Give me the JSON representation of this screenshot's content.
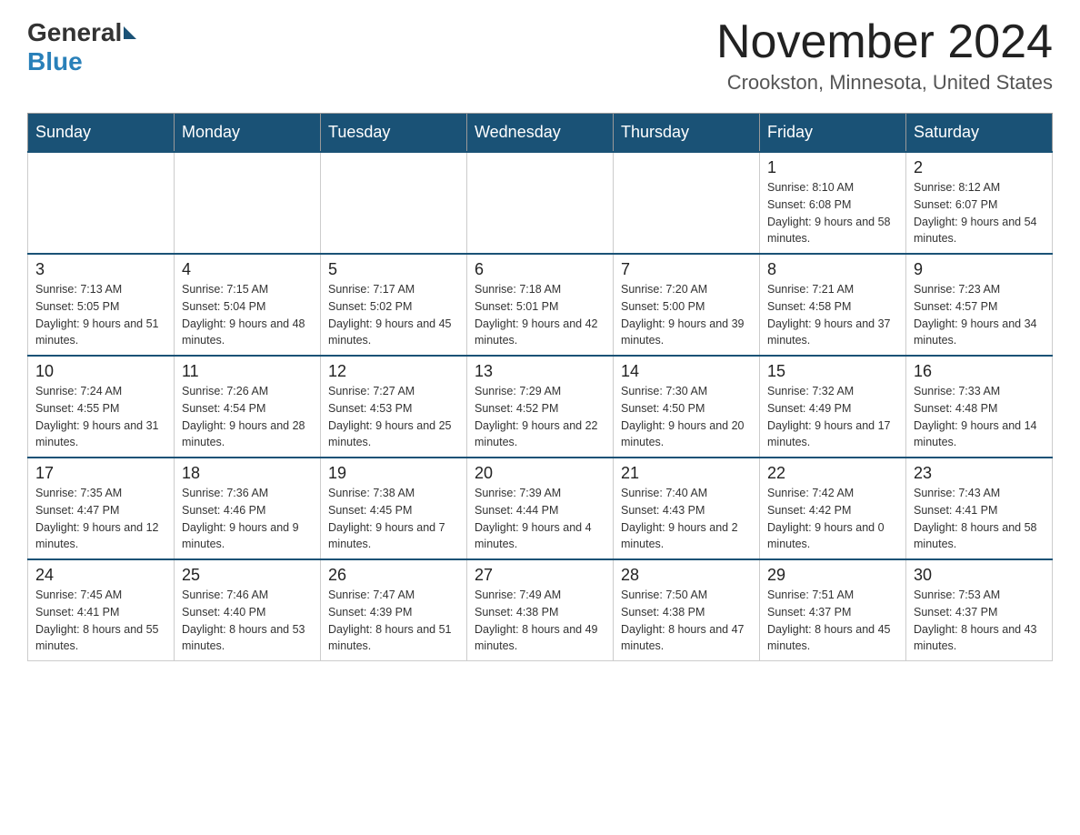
{
  "header": {
    "logo_general": "General",
    "logo_blue": "Blue",
    "month_title": "November 2024",
    "location": "Crookston, Minnesota, United States"
  },
  "days_of_week": [
    "Sunday",
    "Monday",
    "Tuesday",
    "Wednesday",
    "Thursday",
    "Friday",
    "Saturday"
  ],
  "weeks": [
    [
      {
        "day": "",
        "info": ""
      },
      {
        "day": "",
        "info": ""
      },
      {
        "day": "",
        "info": ""
      },
      {
        "day": "",
        "info": ""
      },
      {
        "day": "",
        "info": ""
      },
      {
        "day": "1",
        "info": "Sunrise: 8:10 AM\nSunset: 6:08 PM\nDaylight: 9 hours and 58 minutes."
      },
      {
        "day": "2",
        "info": "Sunrise: 8:12 AM\nSunset: 6:07 PM\nDaylight: 9 hours and 54 minutes."
      }
    ],
    [
      {
        "day": "3",
        "info": "Sunrise: 7:13 AM\nSunset: 5:05 PM\nDaylight: 9 hours and 51 minutes."
      },
      {
        "day": "4",
        "info": "Sunrise: 7:15 AM\nSunset: 5:04 PM\nDaylight: 9 hours and 48 minutes."
      },
      {
        "day": "5",
        "info": "Sunrise: 7:17 AM\nSunset: 5:02 PM\nDaylight: 9 hours and 45 minutes."
      },
      {
        "day": "6",
        "info": "Sunrise: 7:18 AM\nSunset: 5:01 PM\nDaylight: 9 hours and 42 minutes."
      },
      {
        "day": "7",
        "info": "Sunrise: 7:20 AM\nSunset: 5:00 PM\nDaylight: 9 hours and 39 minutes."
      },
      {
        "day": "8",
        "info": "Sunrise: 7:21 AM\nSunset: 4:58 PM\nDaylight: 9 hours and 37 minutes."
      },
      {
        "day": "9",
        "info": "Sunrise: 7:23 AM\nSunset: 4:57 PM\nDaylight: 9 hours and 34 minutes."
      }
    ],
    [
      {
        "day": "10",
        "info": "Sunrise: 7:24 AM\nSunset: 4:55 PM\nDaylight: 9 hours and 31 minutes."
      },
      {
        "day": "11",
        "info": "Sunrise: 7:26 AM\nSunset: 4:54 PM\nDaylight: 9 hours and 28 minutes."
      },
      {
        "day": "12",
        "info": "Sunrise: 7:27 AM\nSunset: 4:53 PM\nDaylight: 9 hours and 25 minutes."
      },
      {
        "day": "13",
        "info": "Sunrise: 7:29 AM\nSunset: 4:52 PM\nDaylight: 9 hours and 22 minutes."
      },
      {
        "day": "14",
        "info": "Sunrise: 7:30 AM\nSunset: 4:50 PM\nDaylight: 9 hours and 20 minutes."
      },
      {
        "day": "15",
        "info": "Sunrise: 7:32 AM\nSunset: 4:49 PM\nDaylight: 9 hours and 17 minutes."
      },
      {
        "day": "16",
        "info": "Sunrise: 7:33 AM\nSunset: 4:48 PM\nDaylight: 9 hours and 14 minutes."
      }
    ],
    [
      {
        "day": "17",
        "info": "Sunrise: 7:35 AM\nSunset: 4:47 PM\nDaylight: 9 hours and 12 minutes."
      },
      {
        "day": "18",
        "info": "Sunrise: 7:36 AM\nSunset: 4:46 PM\nDaylight: 9 hours and 9 minutes."
      },
      {
        "day": "19",
        "info": "Sunrise: 7:38 AM\nSunset: 4:45 PM\nDaylight: 9 hours and 7 minutes."
      },
      {
        "day": "20",
        "info": "Sunrise: 7:39 AM\nSunset: 4:44 PM\nDaylight: 9 hours and 4 minutes."
      },
      {
        "day": "21",
        "info": "Sunrise: 7:40 AM\nSunset: 4:43 PM\nDaylight: 9 hours and 2 minutes."
      },
      {
        "day": "22",
        "info": "Sunrise: 7:42 AM\nSunset: 4:42 PM\nDaylight: 9 hours and 0 minutes."
      },
      {
        "day": "23",
        "info": "Sunrise: 7:43 AM\nSunset: 4:41 PM\nDaylight: 8 hours and 58 minutes."
      }
    ],
    [
      {
        "day": "24",
        "info": "Sunrise: 7:45 AM\nSunset: 4:41 PM\nDaylight: 8 hours and 55 minutes."
      },
      {
        "day": "25",
        "info": "Sunrise: 7:46 AM\nSunset: 4:40 PM\nDaylight: 8 hours and 53 minutes."
      },
      {
        "day": "26",
        "info": "Sunrise: 7:47 AM\nSunset: 4:39 PM\nDaylight: 8 hours and 51 minutes."
      },
      {
        "day": "27",
        "info": "Sunrise: 7:49 AM\nSunset: 4:38 PM\nDaylight: 8 hours and 49 minutes."
      },
      {
        "day": "28",
        "info": "Sunrise: 7:50 AM\nSunset: 4:38 PM\nDaylight: 8 hours and 47 minutes."
      },
      {
        "day": "29",
        "info": "Sunrise: 7:51 AM\nSunset: 4:37 PM\nDaylight: 8 hours and 45 minutes."
      },
      {
        "day": "30",
        "info": "Sunrise: 7:53 AM\nSunset: 4:37 PM\nDaylight: 8 hours and 43 minutes."
      }
    ]
  ]
}
